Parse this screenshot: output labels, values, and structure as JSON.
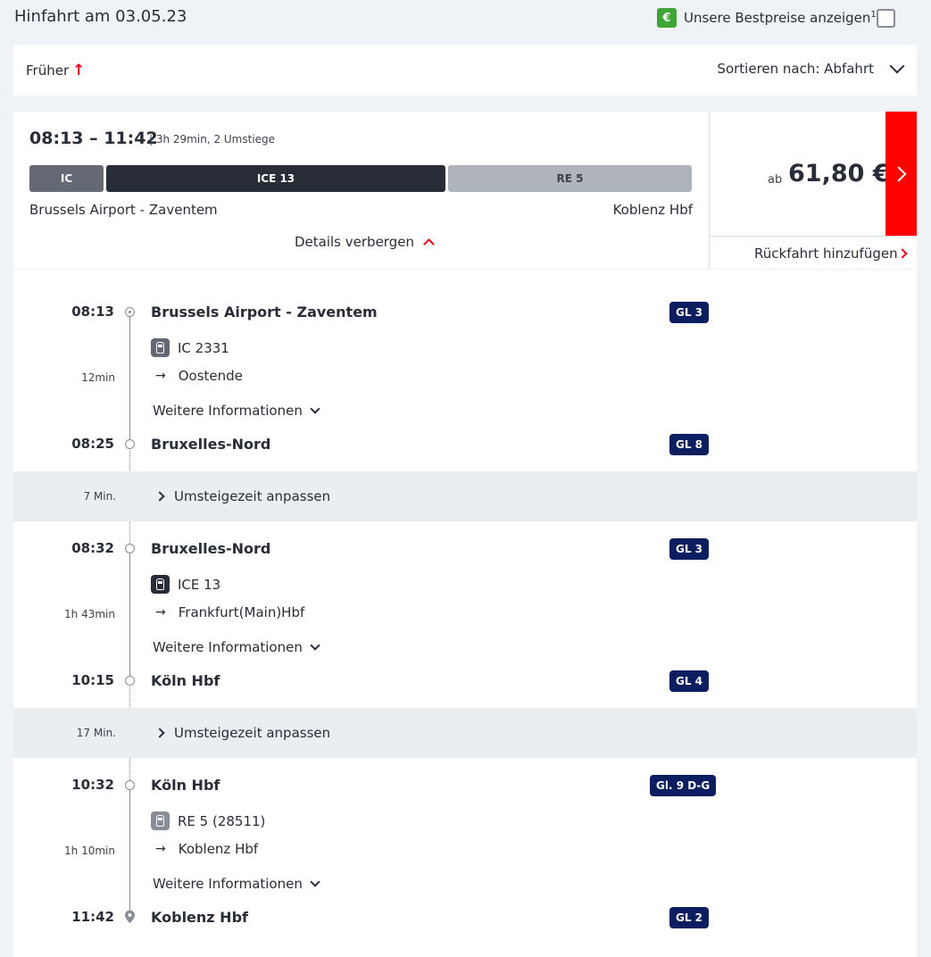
{
  "header": {
    "title": "Hinfahrt am 03.05.23",
    "bestprice_badge": "€",
    "bestprice_label": "Unsere Bestpreise anzeigen",
    "bestprice_footnote": "1"
  },
  "toolbar": {
    "earlier_label": "Früher",
    "earlier_arrow": "↑",
    "sort_label": "Sortieren nach: Abfahrt"
  },
  "connection": {
    "times": "08:13 – 11:42",
    "meta": "| 3h 29min, 2 Umstiege",
    "segments": [
      {
        "label": "IC"
      },
      {
        "label": "ICE 13"
      },
      {
        "label": "RE 5"
      }
    ],
    "from": "Brussels Airport - Zaventem",
    "to": "Koblenz Hbf",
    "details_label": "Details verbergen",
    "price_prefix": "ab",
    "price": "61,80 €",
    "return_label": "Rückfahrt hinzufügen"
  },
  "legs": [
    {
      "dep_time": "08:13",
      "dep_station": "Brussels Airport - Zaventem",
      "dep_platform": "GL 3",
      "train": "IC 2331",
      "direction": "Oostende",
      "duration": "12min",
      "more_label": "Weitere Informationen",
      "arr_time": "08:25",
      "arr_station": "Bruxelles-Nord",
      "arr_platform": "GL 8"
    },
    {
      "dep_time": "08:32",
      "dep_station": "Bruxelles-Nord",
      "dep_platform": "GL 3",
      "train": "ICE 13",
      "direction": "Frankfurt(Main)Hbf",
      "duration": "1h 43min",
      "more_label": "Weitere Informationen",
      "arr_time": "10:15",
      "arr_station": "Köln Hbf",
      "arr_platform": "GL 4"
    },
    {
      "dep_time": "10:32",
      "dep_station": "Köln Hbf",
      "dep_platform": "Gl. 9 D-G",
      "train": "RE 5 (28511)",
      "direction": "Koblenz Hbf",
      "duration": "1h 10min",
      "more_label": "Weitere Informationen",
      "arr_time": "11:42",
      "arr_station": "Koblenz Hbf",
      "arr_platform": "GL 2"
    }
  ],
  "transfers": [
    {
      "duration": "7 Min.",
      "label": "Umsteigezeit anpassen"
    },
    {
      "duration": "17 Min.",
      "label": "Umsteigezeit anpassen"
    }
  ],
  "colors": {
    "accent_red": "#ec0016",
    "cta_red": "#ff0000",
    "platform_navy": "#0c1e5f",
    "bestprice_green": "#3fa535"
  }
}
